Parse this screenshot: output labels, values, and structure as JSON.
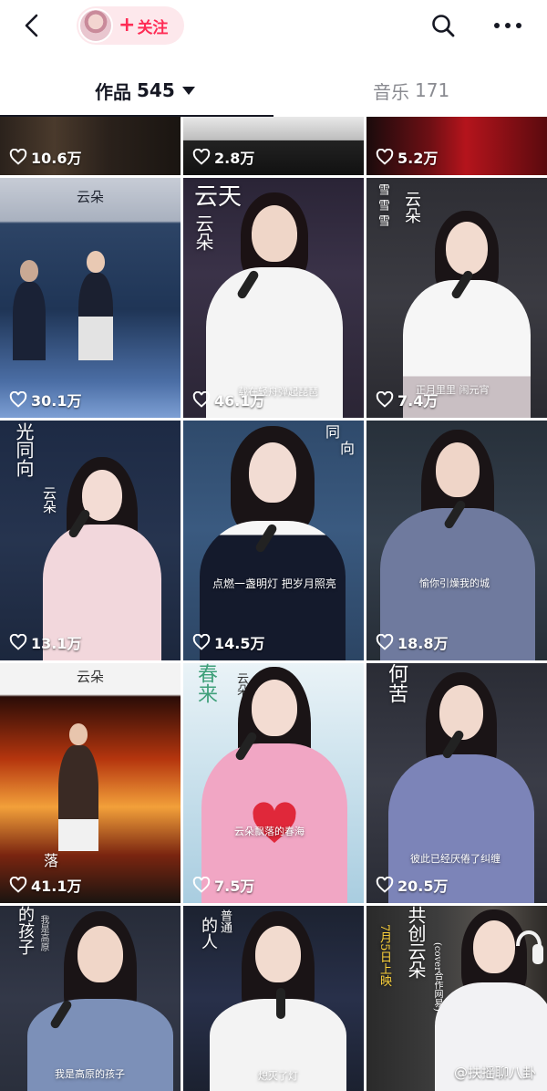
{
  "header": {
    "follow_label": "关注",
    "follow_plus": "+"
  },
  "tabs": {
    "works_label": "作品",
    "works_count": "545",
    "music_label": "音乐",
    "music_count": "171"
  },
  "colors": {
    "accent": "#fe2c55",
    "follow_bg": "#fde8ec",
    "text_primary": "#161823",
    "text_secondary": "#8a8b91"
  },
  "icons": {
    "back": "chevron-left-icon",
    "search": "search-icon",
    "more": "more-dots-icon",
    "heart": "heart-outline-icon"
  },
  "videos": [
    {
      "likes": "10.6万",
      "overlay": ""
    },
    {
      "likes": "2.8万",
      "overlay": ""
    },
    {
      "likes": "5.2万",
      "overlay": ""
    },
    {
      "likes": "30.1万",
      "overlay_title": "云朵",
      "overlay_caption": ""
    },
    {
      "likes": "46.1万",
      "overlay_title": "云天",
      "overlay_sub": "云朵",
      "overlay_caption": "载在轻舟弹起琵琶"
    },
    {
      "likes": "7.4万",
      "overlay_title": "云朵",
      "overlay_sub": "雪 雪 雪",
      "overlay_caption": "正月里里 闹元宵"
    },
    {
      "likes": "13.1万",
      "overlay_title": "光同向",
      "overlay_sub": "云朵"
    },
    {
      "likes": "14.5万",
      "overlay_title": "向",
      "overlay_sub": "同",
      "overlay_caption": "点燃一盏明灯 把岁月照亮"
    },
    {
      "likes": "18.8万",
      "overlay_caption": "愉你引燥我的城"
    },
    {
      "likes": "41.1万",
      "overlay_title": "云朵",
      "overlay_sub": "落"
    },
    {
      "likes": "7.5万",
      "overlay_title": "春来",
      "overlay_sub": "云朵",
      "overlay_caption": "云朵飘落的春海"
    },
    {
      "likes": "20.5万",
      "overlay_title": "何苦",
      "overlay_caption": "彼此已经厌倦了纠缠"
    },
    {
      "likes": "",
      "overlay_title": "的孩子",
      "overlay_sub": "我是高原",
      "overlay_caption": "我是高原的孩子"
    },
    {
      "likes": "",
      "overlay_title": "的人",
      "overlay_sub": "普通",
      "overlay_caption": "熄灭了灯"
    },
    {
      "likes": "",
      "overlay_title": "共创云朵",
      "overlay_sub": "7月5日上映",
      "overlay_caption": "(cover合作网易)"
    }
  ],
  "watermark": "@扶摇聊八卦"
}
